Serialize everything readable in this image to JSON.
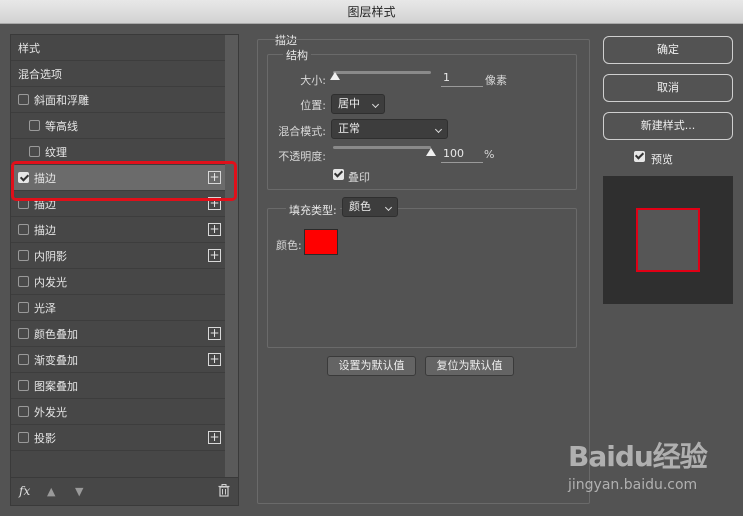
{
  "window": {
    "title": "图层样式"
  },
  "left_panel": {
    "items": [
      {
        "label": "样式",
        "checkbox": false,
        "checked": false,
        "indent": 0,
        "plus": false
      },
      {
        "label": "混合选项",
        "checkbox": false,
        "checked": false,
        "indent": 0,
        "plus": false
      },
      {
        "label": "斜面和浮雕",
        "checkbox": true,
        "checked": false,
        "indent": 0,
        "plus": false
      },
      {
        "label": "等高线",
        "checkbox": true,
        "checked": false,
        "indent": 1,
        "plus": false
      },
      {
        "label": "纹理",
        "checkbox": true,
        "checked": false,
        "indent": 1,
        "plus": false
      },
      {
        "label": "描边",
        "checkbox": true,
        "checked": true,
        "indent": 0,
        "plus": true,
        "selected": true
      },
      {
        "label": "描边",
        "checkbox": true,
        "checked": false,
        "indent": 0,
        "plus": true
      },
      {
        "label": "描边",
        "checkbox": true,
        "checked": false,
        "indent": 0,
        "plus": true
      },
      {
        "label": "内阴影",
        "checkbox": true,
        "checked": false,
        "indent": 0,
        "plus": true
      },
      {
        "label": "内发光",
        "checkbox": true,
        "checked": false,
        "indent": 0,
        "plus": false
      },
      {
        "label": "光泽",
        "checkbox": true,
        "checked": false,
        "indent": 0,
        "plus": false
      },
      {
        "label": "颜色叠加",
        "checkbox": true,
        "checked": false,
        "indent": 0,
        "plus": true
      },
      {
        "label": "渐变叠加",
        "checkbox": true,
        "checked": false,
        "indent": 0,
        "plus": true
      },
      {
        "label": "图案叠加",
        "checkbox": true,
        "checked": false,
        "indent": 0,
        "plus": false
      },
      {
        "label": "外发光",
        "checkbox": true,
        "checked": false,
        "indent": 0,
        "plus": false
      },
      {
        "label": "投影",
        "checkbox": true,
        "checked": false,
        "indent": 0,
        "plus": true
      }
    ],
    "footer": {
      "fx_label": "fx"
    }
  },
  "stroke_panel": {
    "title": "描边",
    "structure_title": "结构",
    "size_label": "大小:",
    "size_value": "1",
    "size_unit": "像素",
    "position_label": "位置:",
    "position_value": "居中",
    "blend_label": "混合模式:",
    "blend_value": "正常",
    "opacity_label": "不透明度:",
    "opacity_value": "100",
    "opacity_unit": "%",
    "opacity_fraction": 1.0,
    "overprint_label": "叠印",
    "fill_type_label": "填充类型:",
    "fill_type_value": "颜色",
    "color_label": "颜色:",
    "stroke_color": "#ff0000",
    "make_default_label": "设置为默认值",
    "reset_default_label": "复位为默认值"
  },
  "right_column": {
    "ok_label": "确定",
    "cancel_label": "取消",
    "new_style_label": "新建样式...",
    "preview_label": "预览"
  },
  "watermark": {
    "brand": "Baidu经验",
    "url": "jingyan.baidu.com"
  }
}
